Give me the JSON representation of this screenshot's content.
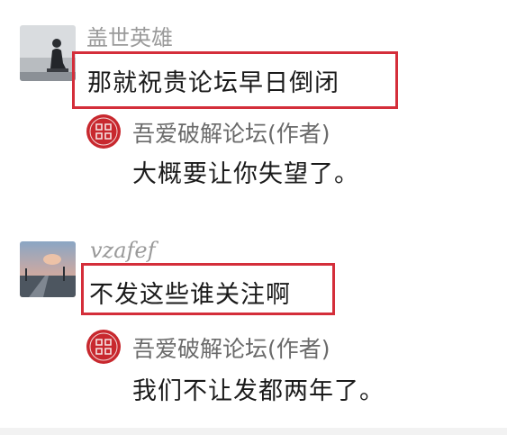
{
  "comments": [
    {
      "username": "盖世英雄",
      "text": "那就祝贵论坛早日倒闭",
      "reply": {
        "author": "吾爱破解论坛(作者)",
        "seal_text": "吾爱破解",
        "text": "大概要让你失望了。"
      }
    },
    {
      "username": "vzafef",
      "text": "不发这些谁关注啊",
      "reply": {
        "author": "吾爱破解论坛(作者)",
        "seal_text": "吾爱破解",
        "text": "我们不让发都两年了。"
      }
    }
  ],
  "colors": {
    "highlight_border": "#d42e3a",
    "seal": "#c8282e",
    "username": "#9a9a9a",
    "author": "#6a6a6a",
    "text": "#1a1a1a"
  },
  "icons": [
    "user-avatar-silhouette",
    "user-avatar-sunset-road",
    "forum-seal-icon"
  ]
}
